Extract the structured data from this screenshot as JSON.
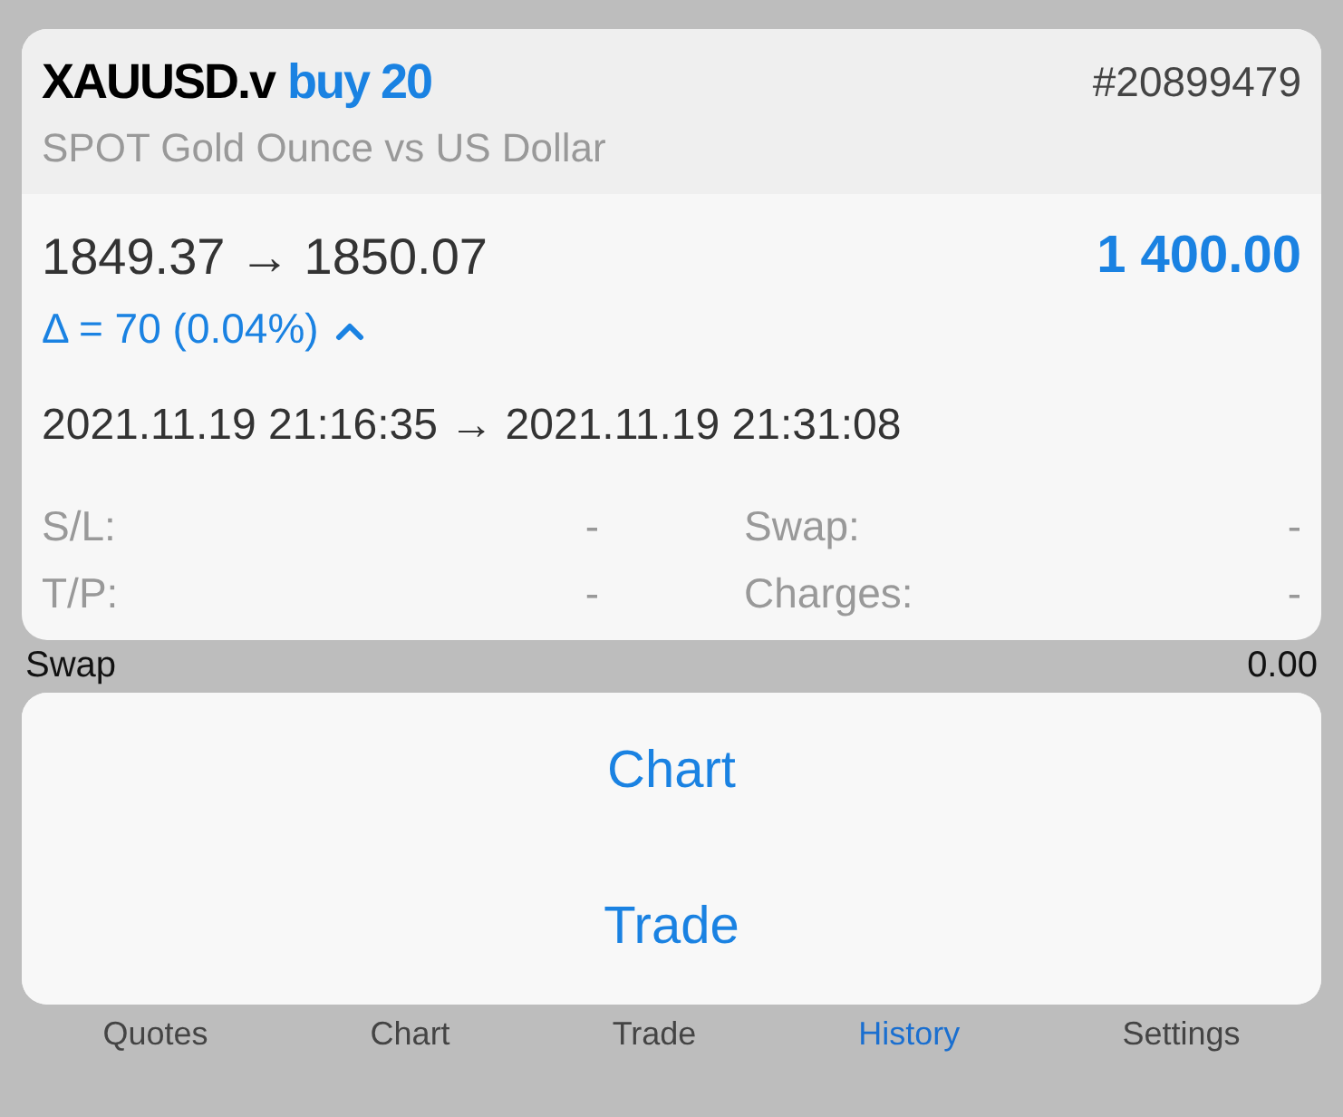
{
  "deal": {
    "symbol": "XAUUSD.v",
    "action": "buy 20",
    "ticket": "#20899479",
    "description": "SPOT Gold Ounce vs US Dollar",
    "prices": "1849.37 → 1850.07",
    "profit": "1 400.00",
    "delta": "Δ = 70 (0.04%)",
    "expanded": true,
    "times": "2021.11.19 21:16:35 → 2021.11.19 21:31:08",
    "details": [
      {
        "label": "S/L:",
        "value": "-"
      },
      {
        "label": "Swap:",
        "value": "-"
      },
      {
        "label": "T/P:",
        "value": "-"
      },
      {
        "label": "Charges:",
        "value": "-"
      }
    ]
  },
  "background_row": {
    "label": "Swap",
    "value": "0.00"
  },
  "actions": [
    "Chart",
    "Trade"
  ],
  "tabs": [
    {
      "label": "Quotes",
      "selected": false
    },
    {
      "label": "Chart",
      "selected": false
    },
    {
      "label": "Trade",
      "selected": false
    },
    {
      "label": "History",
      "selected": true
    },
    {
      "label": "Settings",
      "selected": false
    }
  ]
}
